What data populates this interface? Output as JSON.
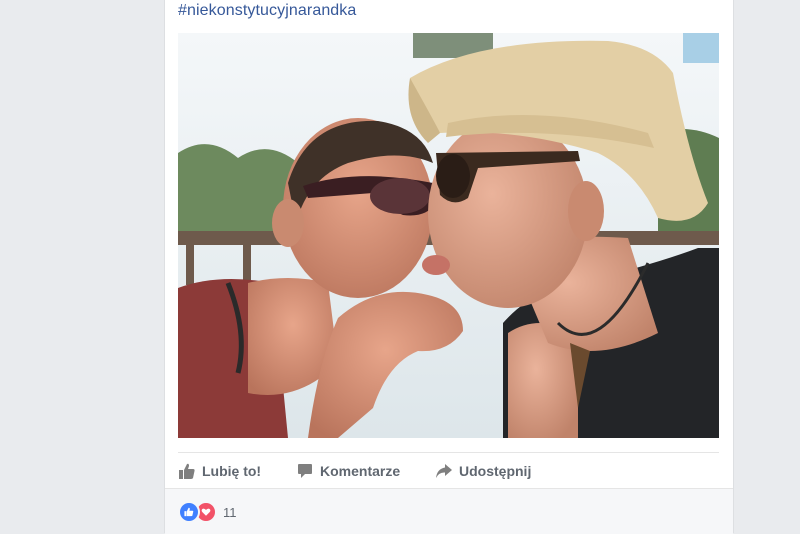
{
  "post": {
    "hashtag": "#niekonstytucyjnarandka",
    "actions": {
      "like_label": "Lubię to!",
      "comment_label": "Komentarze",
      "share_label": "Udostępnij"
    },
    "reactions": {
      "types": [
        "like-icon",
        "love-icon"
      ],
      "count": "11"
    }
  },
  "colors": {
    "link": "#365899",
    "like_blue": "#4080ff",
    "love_red": "#f25268",
    "action_gray": "#606770",
    "page_bg": "#e9ebee"
  }
}
